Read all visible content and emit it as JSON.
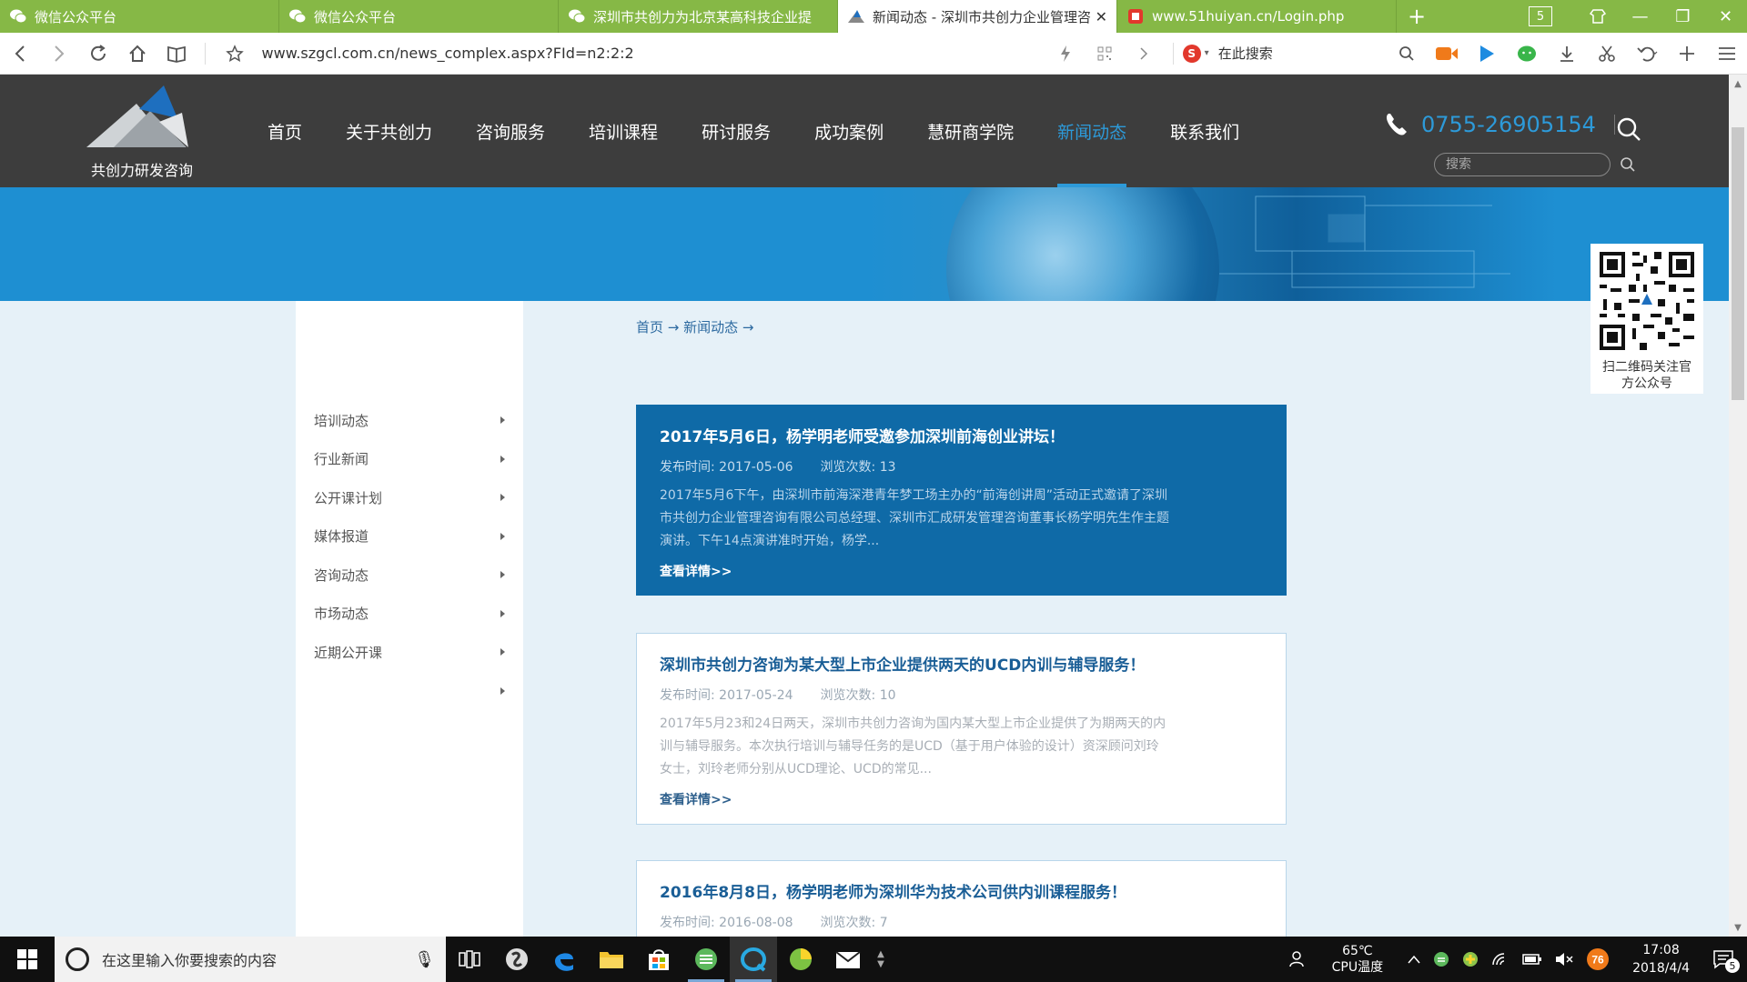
{
  "browser": {
    "tabs": [
      {
        "title": "微信公众平台",
        "icon": "wechat-icon",
        "active": false
      },
      {
        "title": "微信公众平台",
        "icon": "wechat-icon",
        "active": false
      },
      {
        "title": "深圳市共创力为北京某高科技企业提",
        "icon": "wechat-icon",
        "active": false
      },
      {
        "title": "新闻动态 - 深圳市共创力企业管理咨",
        "icon": "site-logo-icon",
        "active": true
      },
      {
        "title": "www.51huiyan.cn/Login.php",
        "icon": "site-icon",
        "active": false
      }
    ],
    "tab_count": "5",
    "url": "www.szgcl.com.cn/news_complex.aspx?FId=n2:2:2",
    "search_placeholder": "在此搜索"
  },
  "site": {
    "logo_text": "共创力研发咨询",
    "nav": [
      "首页",
      "关于共创力",
      "咨询服务",
      "培训课程",
      "研讨服务",
      "成功案例",
      "慧研商学院",
      "新闻动态",
      "联系我们"
    ],
    "active_nav": "新闻动态",
    "phone": "0755-26905154",
    "search_placeholder": "搜索",
    "qr_caption_line1": "扫二维码关注官",
    "qr_caption_line2": "方公众号",
    "colors": {
      "header": "#3d3d3d",
      "accent": "#2d9ad9",
      "featured": "#0f6aa7",
      "page_bg": "#e6f1f8"
    }
  },
  "sidebar": {
    "items": [
      "培训动态",
      "行业新闻",
      "公开课计划",
      "媒体报道",
      "咨询动态",
      "市场动态",
      "近期公开课",
      ""
    ]
  },
  "breadcrumb": "首页 → 新闻动态 →",
  "news": [
    {
      "title": "2017年5月6日，杨学明老师受邀参加深圳前海创业讲坛！",
      "date_label": "发布时间: 2017-05-06",
      "views_label": "浏览次数:   13",
      "desc": "2017年5月6下午，由深圳市前海深港青年梦工场主办的“前海创讲周”活动正式邀请了深圳市共创力企业管理咨询有限公司总经理、深圳市汇成研发管理咨询董事长杨学明先生作主题演讲。下午14点演讲准时开始，杨学...",
      "more": "查看详情>>"
    },
    {
      "title": "深圳市共创力咨询为某大型上市企业提供两天的UCD内训与辅导服务！",
      "date_label": "发布时间: 2017-05-24",
      "views_label": "浏览次数:   10",
      "desc": "2017年5月23和24日两天，深圳市共创力咨询为国内某大型上市企业提供了为期两天的内训与辅导服务。本次执行培训与辅导任务的是UCD（基于用户体验的设计）资深顾问刘玲女士，刘玲老师分别从UCD理论、UCD的常见...",
      "more": "查看详情>>"
    },
    {
      "title": "2016年8月8日，杨学明老师为深圳华为技术公司供内训课程服务！",
      "date_label": "发布时间: 2016-08-08",
      "views_label": "浏览次数:   7",
      "desc": "",
      "more": ""
    }
  ],
  "taskbar": {
    "search_placeholder": "在这里输入你要搜索的内容",
    "cpu_temp": "65℃",
    "cpu_label": "CPU温度",
    "badge": "76",
    "time": "17:08",
    "date": "2018/4/4",
    "notif_count": "5"
  }
}
